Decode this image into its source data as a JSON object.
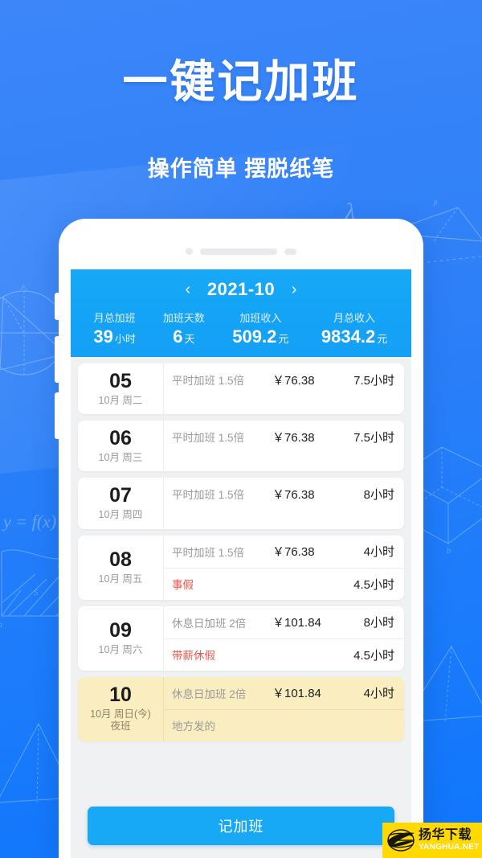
{
  "promo": {
    "title": "一键记加班",
    "subtitle": "操作简单 摆脱纸笔",
    "bg_color": "#2f80f7"
  },
  "phone": {
    "camera_icon": "camera-dot",
    "speaker_icon": "speaker-bar",
    "sensor_icon": "sensor-dot"
  },
  "app": {
    "header": {
      "prev_icon": "‹",
      "next_icon": "›",
      "month": "2021-10",
      "accent_color": "#14a3f6",
      "stats": [
        {
          "label": "月总加班",
          "value": "39",
          "unit": "小时"
        },
        {
          "label": "加班天数",
          "value": "6",
          "unit": "天"
        },
        {
          "label": "加班收入",
          "value": "509.2",
          "unit": "元"
        },
        {
          "label": "月总收入",
          "value": "9834.2",
          "unit": "元"
        }
      ]
    },
    "rows": [
      {
        "day": "05",
        "sub": "10月 周二",
        "today": false,
        "entries": [
          {
            "type": "平时加班 1.5倍",
            "pay": "￥76.38",
            "hours": "7.5小时",
            "leave": false
          }
        ]
      },
      {
        "day": "06",
        "sub": "10月 周三",
        "today": false,
        "entries": [
          {
            "type": "平时加班 1.5倍",
            "pay": "￥76.38",
            "hours": "7.5小时",
            "leave": false
          }
        ]
      },
      {
        "day": "07",
        "sub": "10月 周四",
        "today": false,
        "entries": [
          {
            "type": "平时加班 1.5倍",
            "pay": "￥76.38",
            "hours": "8小时",
            "leave": false
          }
        ]
      },
      {
        "day": "08",
        "sub": "10月 周五",
        "today": false,
        "entries": [
          {
            "type": "平时加班 1.5倍",
            "pay": "￥76.38",
            "hours": "4小时",
            "leave": false
          },
          {
            "type": "事假",
            "pay": "",
            "hours": "4.5小时",
            "leave": true
          }
        ]
      },
      {
        "day": "09",
        "sub": "10月 周六",
        "today": false,
        "entries": [
          {
            "type": "休息日加班 2倍",
            "pay": "￥101.84",
            "hours": "8小时",
            "leave": false
          },
          {
            "type": "带薪休假",
            "pay": "",
            "hours": "4.5小时",
            "leave": true
          }
        ]
      },
      {
        "day": "10",
        "sub": "10月 周日(今)\n夜班",
        "today": true,
        "entries": [
          {
            "type": "休息日加班 2倍",
            "pay": "￥101.84",
            "hours": "4小时",
            "leave": false
          },
          {
            "type": "地方发的",
            "pay": "",
            "hours": "",
            "leave": false,
            "note": true
          }
        ]
      }
    ],
    "cta_label": "记加班"
  },
  "watermark": {
    "cn": "扬华下载",
    "en": "YANGHUA.NET",
    "bg_color": "#ffd900",
    "globe_icon": "globe-swoosh-icon"
  }
}
